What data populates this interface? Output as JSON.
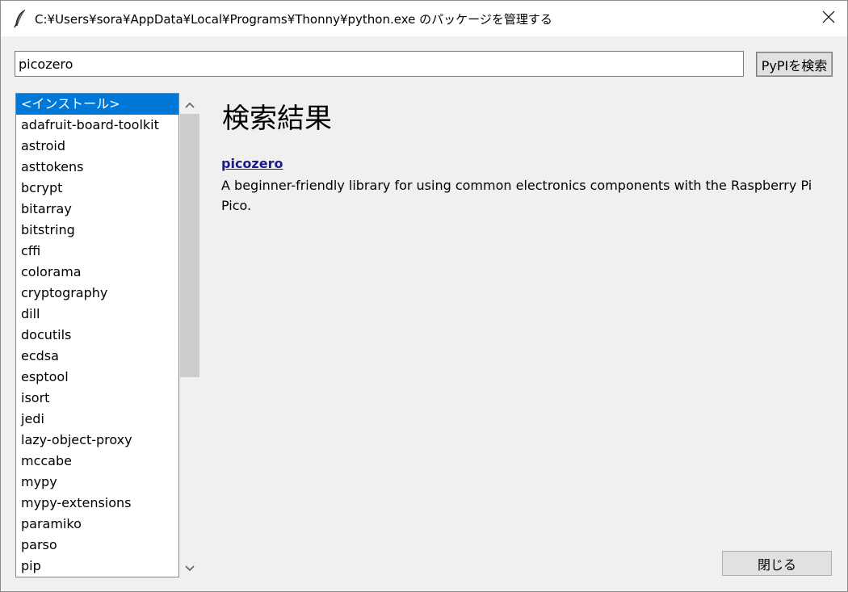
{
  "window": {
    "title": "C:¥Users¥sora¥AppData¥Local¥Programs¥Thonny¥python.exe のパッケージを管理する",
    "icon": "feather-icon",
    "close_icon": "close-icon"
  },
  "search": {
    "value": "picozero",
    "button_label": "PyPIを検索"
  },
  "package_list": {
    "items": [
      "<インストール>",
      "adafruit-board-toolkit",
      "astroid",
      "asttokens",
      "bcrypt",
      "bitarray",
      "bitstring",
      "cffi",
      "colorama",
      "cryptography",
      "dill",
      "docutils",
      "ecdsa",
      "esptool",
      "isort",
      "jedi",
      "lazy-object-proxy",
      "mccabe",
      "mypy",
      "mypy-extensions",
      "paramiko",
      "parso",
      "pip"
    ],
    "selected_index": 0,
    "scroll_up_icon": "chevron-up-icon",
    "scroll_down_icon": "chevron-down-icon"
  },
  "results": {
    "heading": "検索結果",
    "items": [
      {
        "name": "picozero",
        "description": "A beginner-friendly library for using common electronics components with the Raspberry Pi Pico."
      }
    ]
  },
  "footer": {
    "close_label": "閉じる"
  },
  "colors": {
    "selection": "#0078d7",
    "link": "#1a1a8a",
    "background": "#f0f0f0"
  }
}
